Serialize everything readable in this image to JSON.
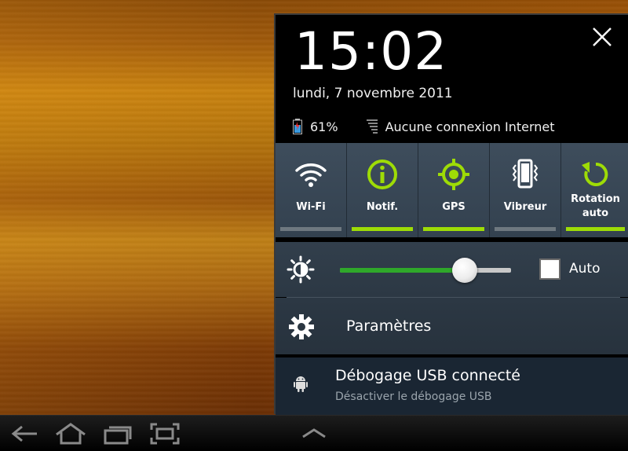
{
  "panel": {
    "time": "15:02",
    "date": "lundi, 7 novembre 2011",
    "battery": "61%",
    "network": "Aucune connexion Internet"
  },
  "quick_settings": [
    {
      "label": "Wi-Fi",
      "icon": "wifi-icon",
      "active": false
    },
    {
      "label": "Notif.",
      "icon": "info-icon",
      "active": true
    },
    {
      "label": "GPS",
      "icon": "gps-icon",
      "active": true
    },
    {
      "label": "Vibreur",
      "icon": "vibrate-icon",
      "active": false
    },
    {
      "label_line1": "Rotation",
      "label_line2": "auto",
      "icon": "rotation-icon",
      "active": true
    }
  ],
  "brightness": {
    "level": 0.73,
    "auto_label": "Auto",
    "auto_checked": false
  },
  "settings": {
    "label": "Paramètres"
  },
  "usb": {
    "title": "Débogage USB connecté",
    "subtitle": "Désactiver le débogage USB"
  },
  "colors": {
    "accent_on": "#9edc06",
    "slider_fill": "#2fa82a",
    "panel_bg": "#000000",
    "quick_bg": "#3e4d5c"
  }
}
